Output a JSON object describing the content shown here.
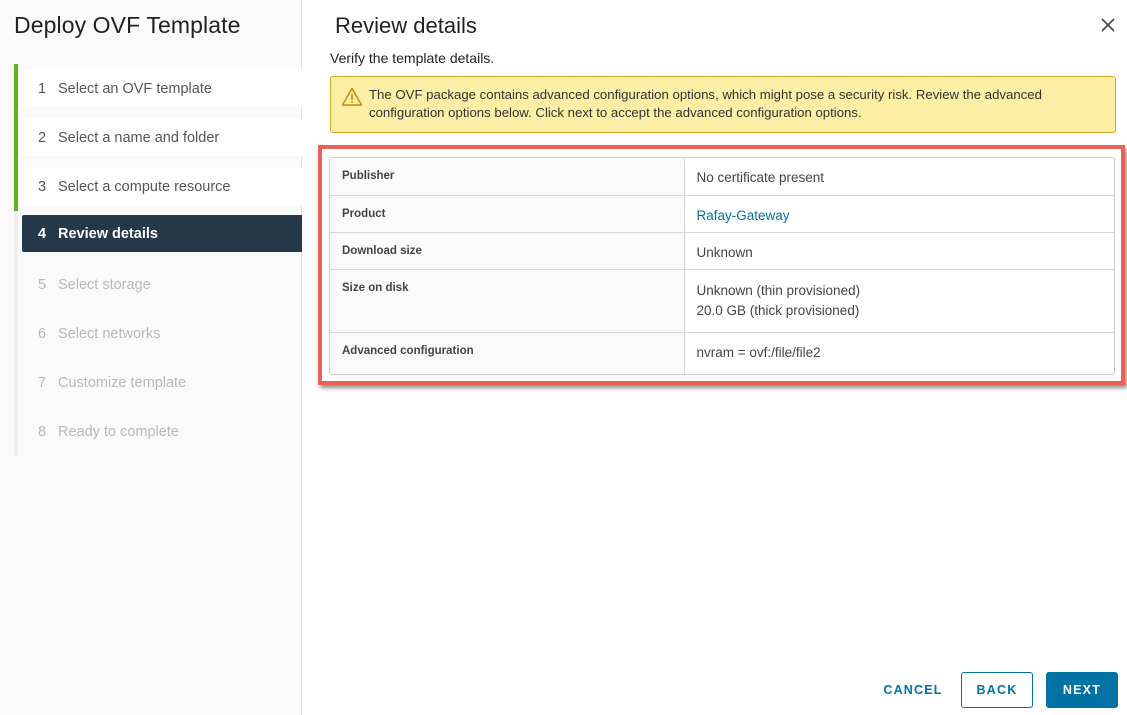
{
  "wizard": {
    "title": "Deploy OVF Template",
    "steps": [
      {
        "number": "1",
        "label": "Select an OVF template",
        "state": "done"
      },
      {
        "number": "2",
        "label": "Select a name and folder",
        "state": "done"
      },
      {
        "number": "3",
        "label": "Select a compute resource",
        "state": "done"
      },
      {
        "number": "4",
        "label": "Review details",
        "state": "current"
      },
      {
        "number": "5",
        "label": "Select storage",
        "state": "future"
      },
      {
        "number": "6",
        "label": "Select networks",
        "state": "future"
      },
      {
        "number": "7",
        "label": "Customize template",
        "state": "future"
      },
      {
        "number": "8",
        "label": "Ready to complete",
        "state": "future"
      }
    ]
  },
  "main": {
    "title": "Review details",
    "subtitle": "Verify the template details.",
    "close_icon": "close-icon",
    "alert": {
      "icon": "warning-icon",
      "text": "The OVF package contains advanced configuration options, which might pose a security risk. Review the advanced configuration options below. Click next to accept the advanced configuration options."
    },
    "details": [
      {
        "key": "Publisher",
        "values": [
          "No certificate present"
        ]
      },
      {
        "key": "Product",
        "values": [
          "Rafay-Gateway"
        ],
        "link": true
      },
      {
        "key": "Download size",
        "values": [
          "Unknown"
        ]
      },
      {
        "key": "Size on disk",
        "values": [
          "Unknown (thin provisioned)",
          "20.0 GB (thick provisioned)"
        ]
      },
      {
        "key": "Advanced configuration",
        "values": [
          "nvram = ovf:/file/file2"
        ]
      }
    ]
  },
  "footer": {
    "cancel_label": "CANCEL",
    "back_label": "BACK",
    "next_label": "NEXT"
  },
  "colors": {
    "accent": "#0072a3",
    "done_step": "#62b01e",
    "current_step_bg": "#25394a",
    "alert_bg": "#fcefa5",
    "highlight_border": "#e8625a"
  }
}
